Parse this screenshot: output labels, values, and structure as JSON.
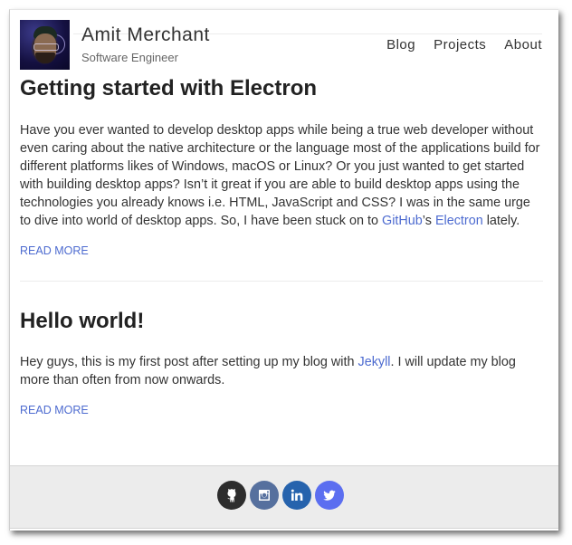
{
  "header": {
    "avatar_alt": "Amit Merchant avatar",
    "site_name": "Amit Merchant",
    "tagline": "Software Engineer",
    "nav": [
      {
        "label": "Blog"
      },
      {
        "label": "Projects"
      },
      {
        "label": "About"
      }
    ]
  },
  "posts": [
    {
      "title": "Getting started with Electron",
      "excerpt_before": "Have you ever wanted to develop desktop apps while being a true web developer without even caring about the native architecture or the language most of the applications build for different platforms likes of Windows, macOS or Linux? Or you just wanted to get started with building desktop apps? Isn’t it great if you are able to build desktop apps using the technologies you already knows i.e. HTML, JavaScript and CSS? I was in the same urge to dive into world of desktop apps. So, I have been stuck on to ",
      "link1": "GitHub",
      "between": "’s ",
      "link2": "Electron",
      "excerpt_after": " lately.",
      "read_more": "READ MORE"
    },
    {
      "title": "Hello world!",
      "excerpt_before": "Hey guys, this is my first post after setting up my blog with ",
      "link1": "Jekyll",
      "excerpt_after": ". I will update my blog more than often from now onwards.",
      "read_more": "READ MORE"
    }
  ],
  "footer": {
    "social": [
      {
        "name": "github",
        "icon": "github-icon",
        "color": "#2d2d2d"
      },
      {
        "name": "instagram",
        "icon": "instagram-icon",
        "color": "#56709e"
      },
      {
        "name": "linkedin",
        "icon": "linkedin-icon",
        "color": "#2663ad"
      },
      {
        "name": "twitter",
        "icon": "twitter-icon",
        "color": "#5b6ef0"
      }
    ]
  },
  "colors": {
    "link": "#4d6bd0",
    "text": "#333333",
    "footer_bg": "#ececec"
  }
}
